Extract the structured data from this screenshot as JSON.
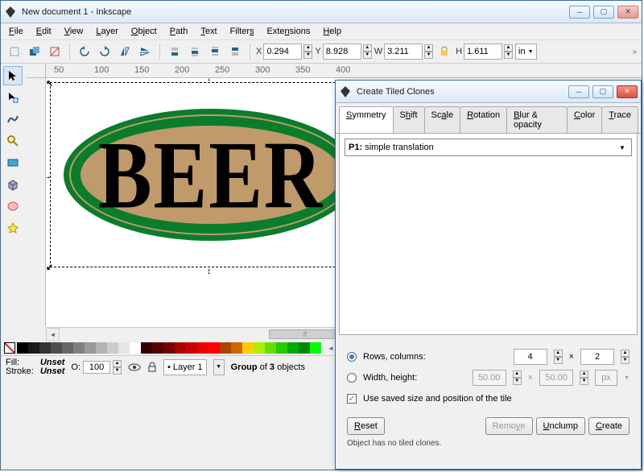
{
  "main": {
    "title": "New document 1 - Inkscape",
    "menu": [
      "File",
      "Edit",
      "View",
      "Layer",
      "Object",
      "Path",
      "Text",
      "Filters",
      "Extensions",
      "Help"
    ],
    "coords": {
      "X": "0.294",
      "Y": "8.928",
      "W": "3.211",
      "H": "1.611",
      "unit": "in"
    },
    "canvas": {
      "label_text": "BEER"
    },
    "ruler": [
      "50",
      "100",
      "150",
      "200",
      "250",
      "300",
      "350",
      "400"
    ],
    "palette": [
      "#000000",
      "#1a1a1a",
      "#333333",
      "#4d4d4d",
      "#666666",
      "#808080",
      "#999999",
      "#b3b3b3",
      "#cccccc",
      "#e6e6e6",
      "#ffffff",
      "#330000",
      "#550000",
      "#770000",
      "#aa0000",
      "#cc0000",
      "#ee0000",
      "#ff0000",
      "#aa4400",
      "#cc6600",
      "#ffcc00",
      "#aaee00",
      "#66dd00",
      "#22cc00",
      "#00aa00",
      "#008800",
      "#00ff00"
    ],
    "status": {
      "fill_label": "Fill:",
      "fill_value": "Unset",
      "stroke_label": "Stroke:",
      "stroke_value": "Unset",
      "opacity_label": "O:",
      "opacity_value": "100",
      "layer": "Layer 1",
      "selection": "Group of 3 objects"
    }
  },
  "dialog": {
    "title": "Create Tiled Clones",
    "tabs": [
      "Symmetry",
      "Shift",
      "Scale",
      "Rotation",
      "Blur & opacity",
      "Color",
      "Trace"
    ],
    "active_tab": 0,
    "combo_label": "P1:",
    "combo_value": "simple translation",
    "rows_label": "Rows, columns:",
    "rows_val": "4",
    "cols_val": "2",
    "wh_label": "Width, height:",
    "w_val": "50.00",
    "h_val": "50.00",
    "wh_unit": "px",
    "use_saved": "Use saved size and position of the tile",
    "reset": "Reset",
    "remove": "Remove",
    "unclump": "Unclump",
    "create": "Create",
    "status": "Object has no tiled clones."
  }
}
